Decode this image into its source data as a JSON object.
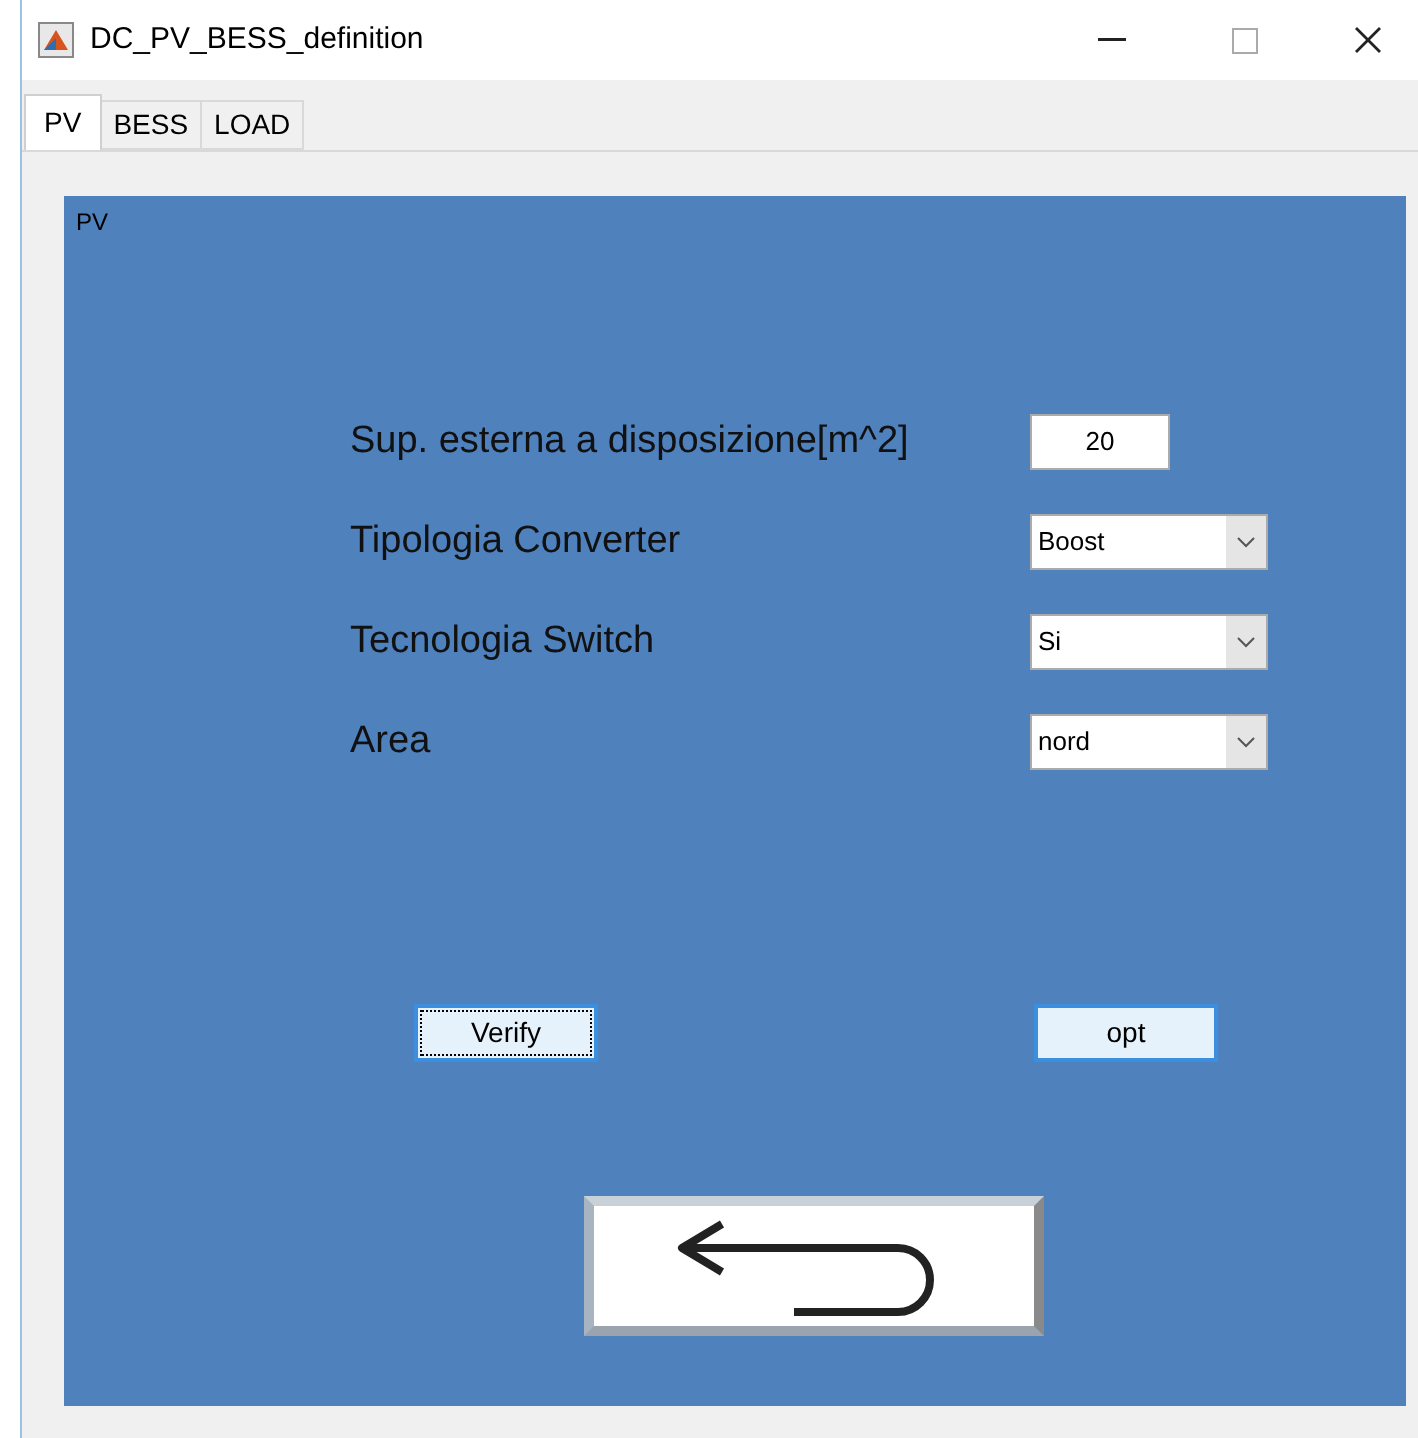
{
  "window": {
    "title": "DC_PV_BESS_definition"
  },
  "tabs": [
    {
      "label": "PV",
      "selected": true
    },
    {
      "label": "BESS",
      "selected": false
    },
    {
      "label": "LOAD",
      "selected": false
    }
  ],
  "panel": {
    "title": "PV",
    "fields": [
      {
        "kind": "input",
        "label": "Sup. esterna a disposizione[m^2]",
        "value": "20"
      },
      {
        "kind": "select",
        "label": "Tipologia Converter",
        "value": "Boost"
      },
      {
        "kind": "select",
        "label": "Tecnologia Switch",
        "value": "Si"
      },
      {
        "kind": "select",
        "label": "Area",
        "value": "nord"
      }
    ],
    "buttons": [
      {
        "label": "Verify",
        "focused": true
      },
      {
        "label": "opt",
        "focused": false
      }
    ]
  }
}
